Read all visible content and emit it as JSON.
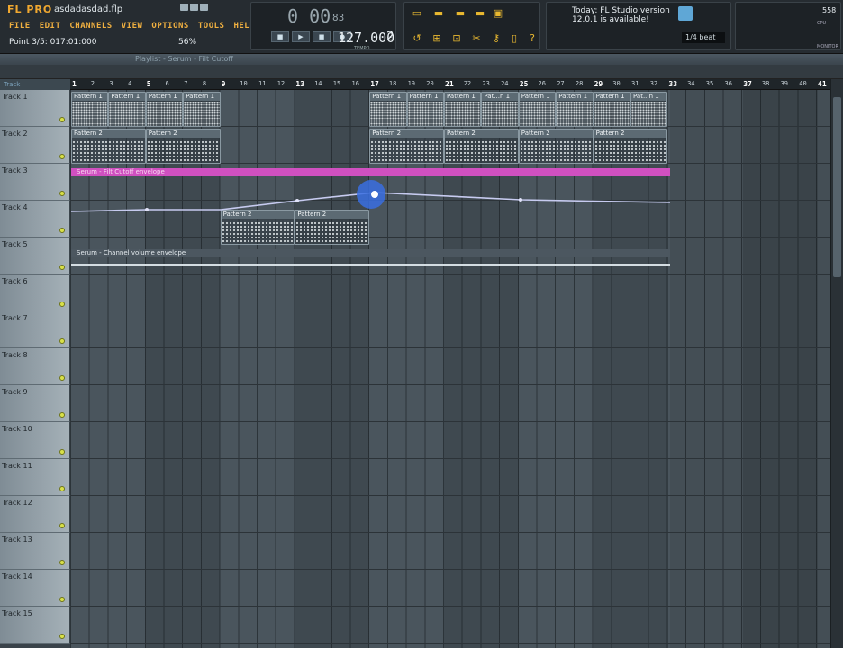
{
  "app": {
    "logo": "FL PRO",
    "filename": "asdadasdad.flp",
    "hint": "Point 3/5: 017:01:000",
    "zoom": "56%"
  },
  "menu": [
    "FILE",
    "EDIT",
    "CHANNELS",
    "VIEW",
    "OPTIONS",
    "TOOLS",
    "HELP"
  ],
  "transport": {
    "time_big": "0 00",
    "time_small": "83",
    "tempo": "127.000",
    "tempo_label": "TEMPO",
    "pattern": "2",
    "buttons": [
      "SONG",
      "PLAY",
      "STOP",
      "REC"
    ]
  },
  "news": {
    "line1": "Today: FL Studio version",
    "line2": "12.0.1 is available!",
    "snap": "1/4 beat"
  },
  "monitor": {
    "cpu": "558",
    "cpu_label": "CPU",
    "monitor_label": "MONITOR"
  },
  "playlist": {
    "title": "Playlist - Serum - Filt Cutoff",
    "header": "Track"
  },
  "ruler": [
    1,
    2,
    3,
    4,
    5,
    6,
    7,
    8,
    9,
    10,
    11,
    12,
    13,
    14,
    15,
    16,
    17,
    18,
    19,
    20,
    21,
    22,
    23,
    24,
    25,
    26,
    27,
    28,
    29,
    30,
    31,
    32,
    33,
    34,
    35,
    36,
    37,
    38,
    39,
    40,
    41
  ],
  "tracks": [
    "Track 1",
    "Track 2",
    "Track 3",
    "Track 4",
    "Track 5",
    "Track 6",
    "Track 7",
    "Track 8",
    "Track 9",
    "Track 10",
    "Track 11",
    "Track 12",
    "Track 13",
    "Track 14",
    "Track 15"
  ],
  "clips": {
    "pattern1": "Pattern 1",
    "pattern1_short": "Pat...n 1",
    "pattern2": "Pattern 2",
    "automation": "Serum - Filt Cutoff envelope",
    "volume": "Serum - Channel volume envelope"
  },
  "colors": {
    "automation": "#d050c0",
    "accent": "#f0b040"
  }
}
